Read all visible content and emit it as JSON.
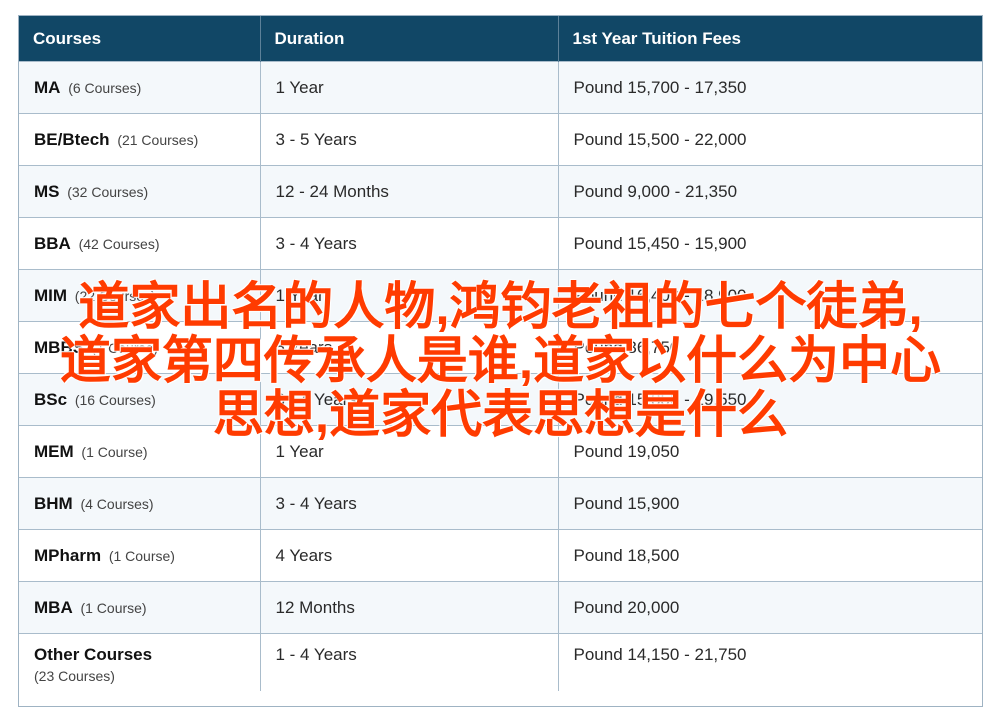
{
  "table": {
    "headers": {
      "courses": "Courses",
      "duration": "Duration",
      "fees": "1st Year Tuition Fees"
    },
    "rows": [
      {
        "course": "MA",
        "count": "(6 Courses)",
        "duration": "1 Year",
        "fees": "Pound 15,700 - 17,350"
      },
      {
        "course": "BE/Btech",
        "count": "(21 Courses)",
        "duration": "3 - 5 Years",
        "fees": "Pound 15,500 - 22,000"
      },
      {
        "course": "MS",
        "count": "(32 Courses)",
        "duration": "12 - 24 Months",
        "fees": "Pound 9,000 - 21,350"
      },
      {
        "course": "BBA",
        "count": "(42 Courses)",
        "duration": "3 - 4 Years",
        "fees": "Pound 15,450 - 15,900"
      },
      {
        "course": "MIM",
        "count": "(22 Courses)",
        "duration": "1 Year",
        "fees": "Pound 16,400 - 18,900"
      },
      {
        "course": "MBBS",
        "count": "(1 Course)",
        "duration": "5 Years",
        "fees": "Pound 36,750"
      },
      {
        "course": "BSc",
        "count": "(16 Courses)",
        "duration": "3 - 4 Years",
        "fees": "Pound 15,850 - 19,550"
      },
      {
        "course": "MEM",
        "count": "(1 Course)",
        "duration": "1 Year",
        "fees": "Pound 19,050"
      },
      {
        "course": "BHM",
        "count": "(4 Courses)",
        "duration": "3 - 4 Years",
        "fees": "Pound 15,900"
      },
      {
        "course": "MPharm",
        "count": "(1 Course)",
        "duration": "4 Years",
        "fees": "Pound 18,500"
      },
      {
        "course": "MBA",
        "count": "(1 Course)",
        "duration": "12 Months",
        "fees": "Pound 20,000"
      },
      {
        "course": "Other Courses",
        "count": "(23 Courses)",
        "duration": "1 - 4 Years",
        "fees": "Pound 14,150 - 21,750"
      }
    ]
  },
  "overlay": {
    "line1": "道家出名的人物,鸿钧老祖的七个徒弟,",
    "line2": "道家第四传承人是谁,道家以什么为中心",
    "line3": "思想,道家代表思想是什么",
    "color": "#ff3b00"
  },
  "colors": {
    "header_bg": "#114766",
    "row_alt_bg": "#f4f8fb",
    "border": "#a9bccb"
  }
}
